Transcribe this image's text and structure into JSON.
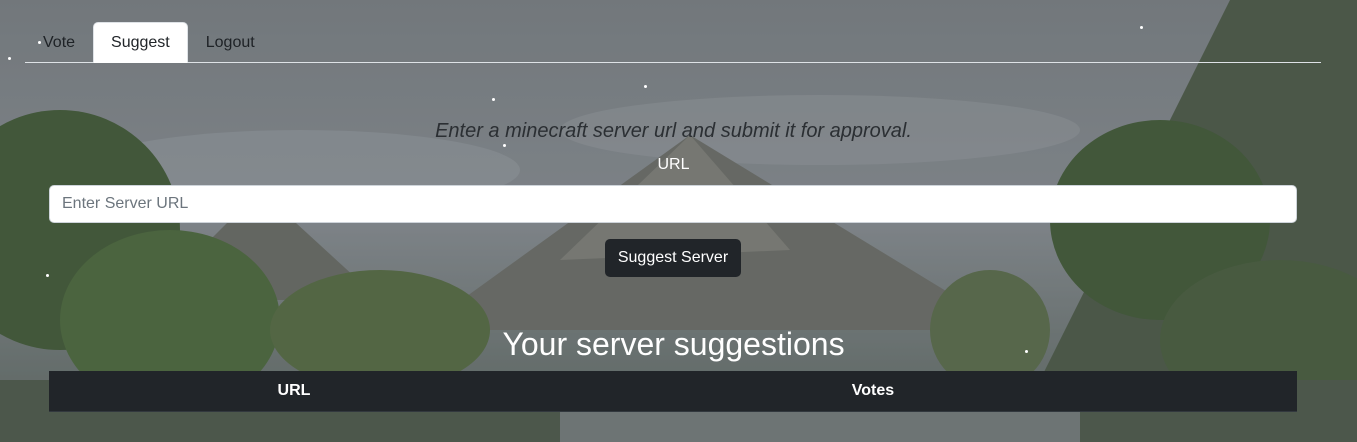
{
  "tabs": [
    {
      "label": "Vote",
      "active": false
    },
    {
      "label": "Suggest",
      "active": true
    },
    {
      "label": "Logout",
      "active": false
    }
  ],
  "form": {
    "instructions": "Enter a minecraft server url and submit it for approval.",
    "url_label": "URL",
    "url_placeholder": "Enter Server URL",
    "url_value": "",
    "submit_label": "Suggest Server"
  },
  "suggestions": {
    "title": "Your server suggestions",
    "columns": [
      "URL",
      "Votes"
    ],
    "rows": []
  },
  "colors": {
    "button_bg": "#212529",
    "table_header_bg": "#212529",
    "active_tab_bg": "#ffffff"
  }
}
